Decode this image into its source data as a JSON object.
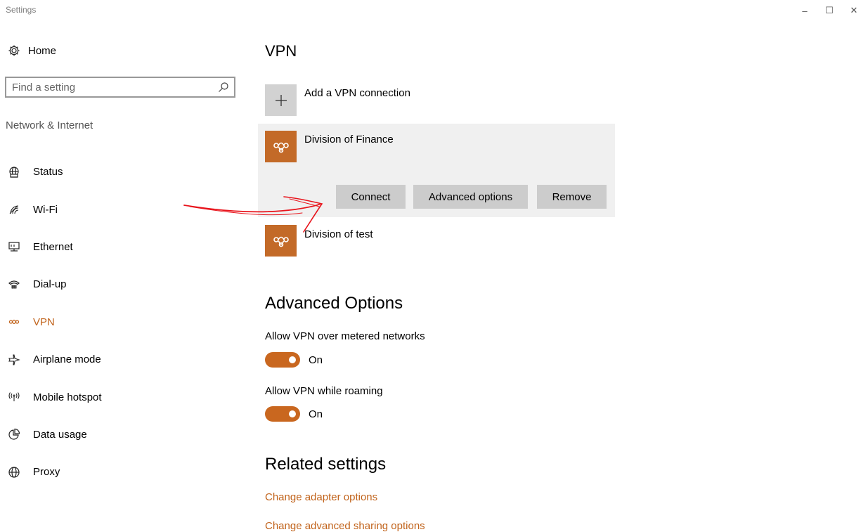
{
  "window": {
    "title": "Settings",
    "controls": {
      "minimize": "–",
      "maximize": "☐",
      "close": "✕"
    }
  },
  "sidebar": {
    "home_label": "Home",
    "search_placeholder": "Find a setting",
    "section_label": "Network & Internet",
    "items": [
      {
        "label": "Status",
        "icon": "globe-monitor-icon"
      },
      {
        "label": "Wi-Fi",
        "icon": "wifi-icon"
      },
      {
        "label": "Ethernet",
        "icon": "ethernet-icon"
      },
      {
        "label": "Dial-up",
        "icon": "dialup-icon"
      },
      {
        "label": "VPN",
        "icon": "vpn-icon",
        "active": true
      },
      {
        "label": "Airplane mode",
        "icon": "airplane-icon"
      },
      {
        "label": "Mobile hotspot",
        "icon": "hotspot-icon"
      },
      {
        "label": "Data usage",
        "icon": "data-usage-icon"
      },
      {
        "label": "Proxy",
        "icon": "globe-icon"
      }
    ]
  },
  "main": {
    "title": "VPN",
    "add_connection_label": "Add a VPN connection",
    "connections": [
      {
        "name": "Division of Finance",
        "expanded": true,
        "buttons": {
          "connect": "Connect",
          "advanced": "Advanced options",
          "remove": "Remove"
        }
      },
      {
        "name": "Division of test",
        "expanded": false
      }
    ],
    "advanced_title": "Advanced Options",
    "options": [
      {
        "label": "Allow VPN over metered networks",
        "state": "On"
      },
      {
        "label": "Allow VPN while roaming",
        "state": "On"
      }
    ],
    "related_title": "Related settings",
    "related_links": [
      "Change adapter options",
      "Change advanced sharing options"
    ]
  },
  "colors": {
    "accent": "#c1631b",
    "toggle_on": "#c9671f",
    "vpn_tile": "#c36a28",
    "annotation": "#e8141c"
  }
}
